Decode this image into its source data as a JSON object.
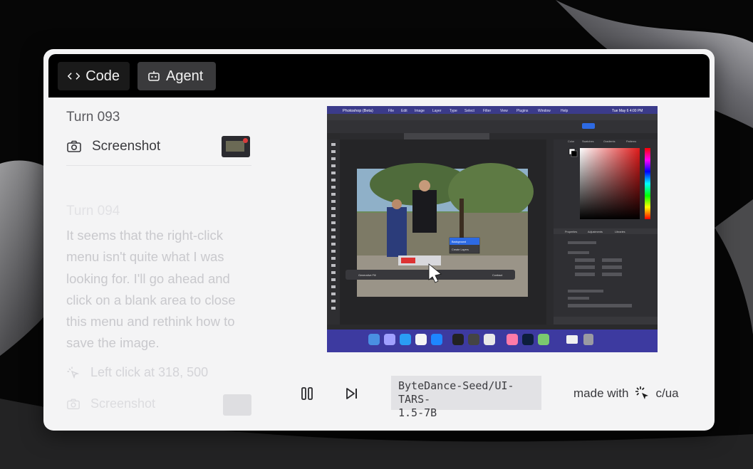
{
  "tabs": [
    {
      "label": "Code",
      "icon": "code-icon"
    },
    {
      "label": "Agent",
      "icon": "robot-icon",
      "active": true
    }
  ],
  "turns": [
    {
      "title": "Turn 093",
      "action_label": "Screenshot",
      "action_icon": "camera-icon"
    },
    {
      "title": "Turn 094",
      "thought": "It seems that the right-click menu isn't quite what I was looking for. I'll go ahead and click on a blank area to close this menu and rethink how to save the image.",
      "click_action": "Left click at 318, 500",
      "click_icon": "pointer-click-icon",
      "screenshot_label": "Screenshot",
      "screenshot_icon": "camera-icon"
    }
  ],
  "controls": {
    "pause_icon": "pause-icon",
    "step_icon": "skip-next-icon",
    "model_line1": "ByteDance-Seed/UI-TARS-",
    "model_line2": "1.5-7B"
  },
  "footer": {
    "made_with": "made with",
    "brand": "c/ua",
    "brand_icon": "cursor-spark-icon"
  },
  "screenshot": {
    "menubar_app": "Photoshop (Beta)",
    "menus": [
      "File",
      "Edit",
      "Image",
      "Layer",
      "Type",
      "Select",
      "Filter",
      "View",
      "Plugins",
      "Window",
      "Help"
    ],
    "clock": "Tue May 6 4:00 PM",
    "context_menu_items": [
      "Background",
      "Create Layers"
    ],
    "taskbar_items": [
      "Generative Fill",
      "Contract"
    ],
    "panel_tabs": [
      "Color",
      "Swatches",
      "Gradients",
      "Patterns"
    ],
    "props_tabs": [
      "Properties",
      "Adjustments",
      "Libraries"
    ],
    "colors": {
      "accent": "#2d6ae3",
      "dock": "#3d3aa0"
    }
  }
}
